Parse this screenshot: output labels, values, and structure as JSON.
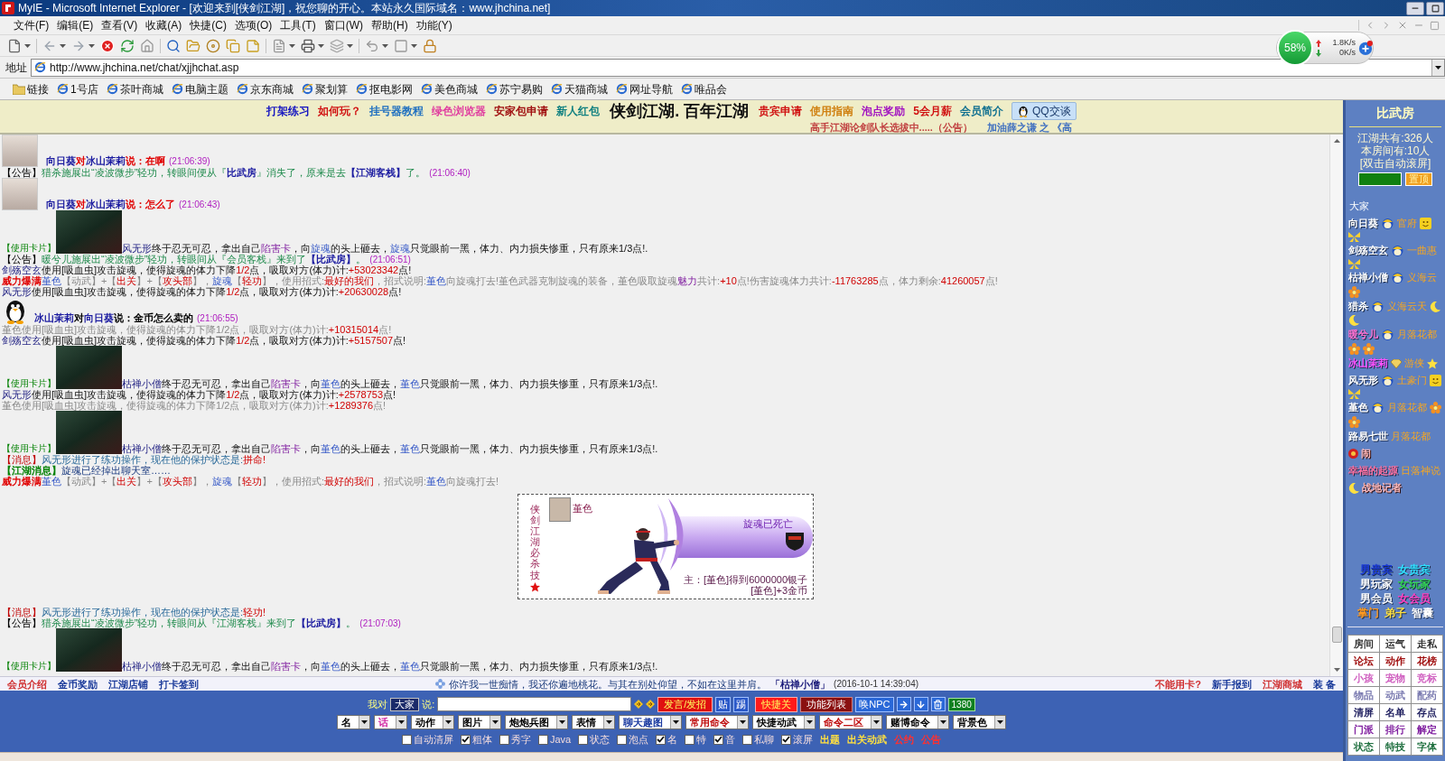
{
  "window": {
    "title": "MyIE - Microsoft Internet Explorer - [欢迎来到[侠剑江湖]，祝您聊的开心。本站永久国际域名：www.jhchina.net]"
  },
  "menu": [
    "文件(F)",
    "编辑(E)",
    "查看(V)",
    "收藏(A)",
    "快捷(C)",
    "选项(O)",
    "工具(T)",
    "窗口(W)",
    "帮助(H)",
    "功能(Y)"
  ],
  "address": {
    "label": "地址",
    "value": "http://www.jhchina.net/chat/xjjhchat.asp"
  },
  "links": [
    "链接",
    "1号店",
    "茶叶商城",
    "电脑主题",
    "京东商城",
    "聚划算",
    "抠电影网",
    "美色商城",
    "苏宁易购",
    "天猫商城",
    "网址导航",
    "唯品会"
  ],
  "speed_widget": {
    "percent": "58%",
    "up": "1.8K/s",
    "down": "0K/s"
  },
  "header": {
    "links": [
      {
        "text": "打架练习",
        "color": "#1010c0"
      },
      {
        "text": "如何玩？",
        "color": "#d01010"
      },
      {
        "text": "挂号器教程",
        "color": "#2070c0"
      },
      {
        "text": "绿色浏览器",
        "color": "#e040a0"
      },
      {
        "text": "安家包申请",
        "color": "#a01010"
      },
      {
        "text": "新人红包",
        "color": "#108080"
      }
    ],
    "title": "侠剑江湖. 百年江湖",
    "links_right": [
      {
        "text": "贵宾申请",
        "color": "#d01010"
      },
      {
        "text": "使用指南",
        "color": "#d08010"
      },
      {
        "text": "泡点奖励",
        "color": "#a010c0"
      },
      {
        "text": "5会月薪",
        "color": "#d01010"
      },
      {
        "text": "会员简介",
        "color": "#107090"
      }
    ],
    "qq_button": "QQ交谈",
    "marquee": [
      {
        "text": "高手江湖论剑队长选拔中.....（公告）",
        "color": "#c04040"
      },
      {
        "text": "加油薛之谦 之 《高",
        "color": "#4070c0"
      }
    ]
  },
  "chat": {
    "messages": [
      {
        "kind": "photo_avatar",
        "segments": [
          {
            "kind": "speaker",
            "text": "向日葵"
          },
          {
            "kind": "say",
            "text": "对"
          },
          {
            "kind": "speaker",
            "text": "冰山茉莉"
          },
          {
            "kind": "say",
            "text": "说：在啊"
          },
          {
            "kind": "time",
            "text": "(21:06:39)"
          }
        ]
      },
      {
        "kind": "text",
        "segments": [
          {
            "kind": "notice_tag",
            "text": "【公告】"
          },
          {
            "kind": "notice",
            "text": "猎杀施展出“凌波微步”轻功，转眼间便从『"
          },
          {
            "kind": "place",
            "text": "比武房"
          },
          {
            "kind": "notice",
            "text": "』消失了，原来是去"
          },
          {
            "kind": "place",
            "text": "【江湖客栈】"
          },
          {
            "kind": "notice",
            "text": "了。"
          },
          {
            "kind": "time",
            "text": "(21:06:40)"
          }
        ]
      },
      {
        "kind": "photo_avatar",
        "segments": [
          {
            "kind": "speaker",
            "text": "向日葵"
          },
          {
            "kind": "say",
            "text": "对"
          },
          {
            "kind": "speaker",
            "text": "冰山茉莉"
          },
          {
            "kind": "say",
            "text": "说：怎么了"
          },
          {
            "kind": "time",
            "text": "(21:06:43)"
          }
        ]
      },
      {
        "kind": "card",
        "tag": "【使用卡片】",
        "segments": [
          {
            "kind": "player",
            "text": "风无形"
          },
          {
            "kind": "text",
            "text": "终于忍无可忍，拿出自己"
          },
          {
            "kind": "item",
            "text": "陷害卡"
          },
          {
            "kind": "text",
            "text": "，向"
          },
          {
            "kind": "target",
            "text": "旋魂"
          },
          {
            "kind": "text",
            "text": "的头上砸去，"
          },
          {
            "kind": "target",
            "text": "旋魂"
          },
          {
            "kind": "text",
            "text": "只觉眼前一黑，体力、内力损失惨重，只有原来1/3点!."
          }
        ]
      },
      {
        "kind": "text",
        "segments": [
          {
            "kind": "notice_tag",
            "text": "【公告】"
          },
          {
            "kind": "notice",
            "text": "暖兮儿施展出“凌波微步”轻功，转眼间从『会员客栈』来到了"
          },
          {
            "kind": "place",
            "text": "【比武房】"
          },
          {
            "kind": "notice",
            "text": "。"
          },
          {
            "kind": "time",
            "text": "(21:06:51)"
          }
        ]
      },
      {
        "kind": "text",
        "segments": [
          {
            "kind": "player",
            "text": "剑殇空玄"
          },
          {
            "kind": "text",
            "text": "使用[吸血虫]攻击旋魂，使得旋魂的体力下降"
          },
          {
            "kind": "num",
            "text": "1/2"
          },
          {
            "kind": "text",
            "text": "点，吸取对方(体力)计:"
          },
          {
            "kind": "num",
            "text": "+53023342"
          },
          {
            "kind": "text",
            "text": "点!"
          }
        ]
      },
      {
        "kind": "text",
        "segments": [
          {
            "kind": "power",
            "text": "威力爆满"
          },
          {
            "kind": "target",
            "text": "堇色"
          },
          {
            "kind": "dim",
            "text": "【动武】+【"
          },
          {
            "kind": "red",
            "text": "出关"
          },
          {
            "kind": "dim",
            "text": "】+【"
          },
          {
            "kind": "red",
            "text": "攻头部"
          },
          {
            "kind": "dim",
            "text": "】，"
          },
          {
            "kind": "target",
            "text": "旋魂"
          },
          {
            "kind": "dim",
            "text": "【"
          },
          {
            "kind": "red",
            "text": "轻功"
          },
          {
            "kind": "dim",
            "text": "】，使用招式:"
          },
          {
            "kind": "red",
            "text": "最好的我们"
          },
          {
            "kind": "dim",
            "text": "，招式说明:"
          },
          {
            "kind": "target",
            "text": "堇色"
          },
          {
            "kind": "dim",
            "text": "向旋魂打去!堇色武器克制旋魂的装备，堇色吸取旋魂"
          },
          {
            "kind": "item",
            "text": "魅力"
          },
          {
            "kind": "dim",
            "text": "共计:"
          },
          {
            "kind": "num",
            "text": "+10"
          },
          {
            "kind": "dim",
            "text": "点!伤害旋魂体力共计:"
          },
          {
            "kind": "num",
            "text": "-11763285"
          },
          {
            "kind": "dim",
            "text": "点，体力剩余:"
          },
          {
            "kind": "num",
            "text": "41260057"
          },
          {
            "kind": "dim",
            "text": "点!"
          }
        ]
      },
      {
        "kind": "text",
        "segments": [
          {
            "kind": "player",
            "text": "风无形"
          },
          {
            "kind": "text",
            "text": "使用[吸血虫]攻击旋魂，使得旋魂的体力下降"
          },
          {
            "kind": "num",
            "text": "1/2"
          },
          {
            "kind": "text",
            "text": "点，吸取对方(体力)计:"
          },
          {
            "kind": "num",
            "text": "+20630028"
          },
          {
            "kind": "text",
            "text": "点!"
          }
        ]
      },
      {
        "kind": "penguin_avatar",
        "segments": [
          {
            "kind": "speaker",
            "text": "冰山茉莉"
          },
          {
            "kind": "talk",
            "text": "对"
          },
          {
            "kind": "speaker",
            "text": "向日葵"
          },
          {
            "kind": "talk",
            "text": "说：金币怎么卖的"
          },
          {
            "kind": "time",
            "text": "(21:06:55)"
          }
        ]
      },
      {
        "kind": "text",
        "segments": [
          {
            "kind": "dim",
            "text": "堇色使用[吸血虫]攻击旋魂，使得旋魂的体力下降1/2点，吸取对方(体力)计:"
          },
          {
            "kind": "num",
            "text": "+10315014"
          },
          {
            "kind": "dim",
            "text": "点!"
          }
        ]
      },
      {
        "kind": "text",
        "segments": [
          {
            "kind": "player",
            "text": "剑殇空玄"
          },
          {
            "kind": "text",
            "text": "使用[吸血虫]攻击旋魂，使得旋魂的体力下降"
          },
          {
            "kind": "num",
            "text": "1/2"
          },
          {
            "kind": "text",
            "text": "点，吸取对方(体力)计:"
          },
          {
            "kind": "num",
            "text": "+5157507"
          },
          {
            "kind": "text",
            "text": "点!"
          }
        ]
      },
      {
        "kind": "card",
        "tag": "【使用卡片】",
        "segments": [
          {
            "kind": "player",
            "text": "枯禅小僧"
          },
          {
            "kind": "text",
            "text": "终于忍无可忍，拿出自己"
          },
          {
            "kind": "item",
            "text": "陷害卡"
          },
          {
            "kind": "text",
            "text": "，向"
          },
          {
            "kind": "target",
            "text": "堇色"
          },
          {
            "kind": "text",
            "text": "的头上砸去，"
          },
          {
            "kind": "target",
            "text": "堇色"
          },
          {
            "kind": "text",
            "text": "只觉眼前一黑，体力、内力损失惨重，只有原来1/3点!."
          }
        ]
      },
      {
        "kind": "text",
        "segments": [
          {
            "kind": "player",
            "text": "风无形"
          },
          {
            "kind": "text",
            "text": "使用[吸血虫]攻击旋魂，使得旋魂的体力下降"
          },
          {
            "kind": "num",
            "text": "1/2"
          },
          {
            "kind": "text",
            "text": "点，吸取对方(体力)计:"
          },
          {
            "kind": "num",
            "text": "+2578753"
          },
          {
            "kind": "text",
            "text": "点!"
          }
        ]
      },
      {
        "kind": "text",
        "segments": [
          {
            "kind": "dim",
            "text": "堇色使用[吸血虫]攻击旋魂，使得旋魂的体力下降1/2点，吸取对方(体力)计:"
          },
          {
            "kind": "num",
            "text": "+1289376"
          },
          {
            "kind": "dim",
            "text": "点!"
          }
        ]
      },
      {
        "kind": "card",
        "tag": "【使用卡片】",
        "segments": [
          {
            "kind": "player",
            "text": "枯禅小僧"
          },
          {
            "kind": "text",
            "text": "终于忍无可忍，拿出自己"
          },
          {
            "kind": "item",
            "text": "陷害卡"
          },
          {
            "kind": "text",
            "text": "，向"
          },
          {
            "kind": "target",
            "text": "堇色"
          },
          {
            "kind": "text",
            "text": "的头上砸去，"
          },
          {
            "kind": "target",
            "text": "堇色"
          },
          {
            "kind": "text",
            "text": "只觉眼前一黑，体力、内力损失惨重，只有原来1/3点!."
          }
        ]
      },
      {
        "kind": "text",
        "segments": [
          {
            "kind": "msg_tag",
            "text": "【消息】"
          },
          {
            "kind": "msg",
            "text": "风无形进行了练功操作，现在他的保护状态是:"
          },
          {
            "kind": "red",
            "text": "拼命!"
          }
        ]
      },
      {
        "kind": "text",
        "segments": [
          {
            "kind": "news_tag",
            "text": "【江湖消息】"
          },
          {
            "kind": "news",
            "text": "旋魂已经掉出聊天室……"
          }
        ]
      },
      {
        "kind": "text",
        "segments": [
          {
            "kind": "power",
            "text": "威力爆满"
          },
          {
            "kind": "target",
            "text": "堇色"
          },
          {
            "kind": "dim",
            "text": "【动武】+【"
          },
          {
            "kind": "red",
            "text": "出关"
          },
          {
            "kind": "dim",
            "text": "】+【"
          },
          {
            "kind": "red",
            "text": "攻头部"
          },
          {
            "kind": "dim",
            "text": "】，"
          },
          {
            "kind": "target",
            "text": "旋魂"
          },
          {
            "kind": "dim",
            "text": "【"
          },
          {
            "kind": "red",
            "text": "轻功"
          },
          {
            "kind": "dim",
            "text": "】，使用招式:"
          },
          {
            "kind": "red",
            "text": "最好的我们"
          },
          {
            "kind": "dim",
            "text": "，招式说明:"
          },
          {
            "kind": "target",
            "text": "堇色"
          },
          {
            "kind": "dim",
            "text": "向旋魂打去!"
          }
        ]
      },
      {
        "kind": "battle",
        "caption": "侠剑江湖必杀技",
        "fighter": "堇色",
        "status": "旋魂已死亡",
        "rewards": [
          "主：[堇色]得到6000000银子",
          "[堇色]+3金币"
        ]
      },
      {
        "kind": "text",
        "segments": [
          {
            "kind": "msg_tag",
            "text": "【消息】"
          },
          {
            "kind": "msg",
            "text": "风无形进行了练功操作，现在他的保护状态是:"
          },
          {
            "kind": "red",
            "text": "轻功!"
          }
        ]
      },
      {
        "kind": "text",
        "segments": [
          {
            "kind": "notice_tag",
            "text": "【公告】"
          },
          {
            "kind": "notice",
            "text": "猎杀施展出“凌波微步”轻功，转眼间从『江湖客栈』来到了"
          },
          {
            "kind": "place",
            "text": "【比武房】"
          },
          {
            "kind": "notice",
            "text": "。"
          },
          {
            "kind": "time",
            "text": "(21:07:03)"
          }
        ]
      },
      {
        "kind": "card",
        "tag": "【使用卡片】",
        "segments": [
          {
            "kind": "player",
            "text": "枯禅小僧"
          },
          {
            "kind": "text",
            "text": "终于忍无可忍，拿出自己"
          },
          {
            "kind": "item",
            "text": "陷害卡"
          },
          {
            "kind": "text",
            "text": "，向"
          },
          {
            "kind": "target",
            "text": "堇色"
          },
          {
            "kind": "text",
            "text": "的头上砸去，"
          },
          {
            "kind": "target",
            "text": "堇色"
          },
          {
            "kind": "text",
            "text": "只觉眼前一黑，体力、内力损失惨重，只有原来1/3点!."
          }
        ]
      }
    ]
  },
  "bottom_bar": {
    "left_links": [
      {
        "text": "会员介绍",
        "color": "#d03030"
      },
      {
        "text": "金币奖励",
        "color": "#1a3a9a"
      },
      {
        "text": "江湖店铺",
        "color": "#1a3a9a"
      },
      {
        "text": "打卡签到",
        "color": "#1a3a9a"
      }
    ],
    "quote": "你许我一世痴情，我还你遍地桃花。与其在别处仰望，不如在这里并肩。",
    "quote_author": "「枯禅小僧」",
    "quote_time": "(2016-10-1 14:39:04)",
    "right_links": [
      {
        "text": "不能用卡?",
        "color": "#d03030"
      },
      {
        "text": "新手报到",
        "color": "#1a3a9a"
      },
      {
        "text": "江湖商城",
        "color": "#d03030"
      },
      {
        "text": "装 备",
        "color": "#1a3a9a"
      }
    ]
  },
  "composer": {
    "to_label": "我对",
    "to_value": "大家",
    "say_label": "说:",
    "buttons": [
      {
        "kind": "send",
        "text": "发言/发招"
      },
      {
        "kind": "small",
        "text": "贴"
      },
      {
        "kind": "small",
        "text": "踢"
      },
      {
        "kind": "hot",
        "text": "快捷关"
      },
      {
        "kind": "menu",
        "text": "功能列表"
      },
      {
        "kind": "npc",
        "text": "唤NPC"
      }
    ],
    "counter": "1380",
    "selects": [
      {
        "value": "名",
        "color": "#000000"
      },
      {
        "value": "话",
        "color": "#d020a0"
      },
      {
        "value": "动作",
        "color": "#000000"
      },
      {
        "value": "图片",
        "color": "#000000"
      },
      {
        "value": "炮炮兵图",
        "color": "#000000"
      },
      {
        "value": "表情",
        "color": "#000000"
      },
      {
        "value": "聊天趣图",
        "color": "#1a3aa0"
      },
      {
        "value": "常用命令",
        "color": "#c01010"
      },
      {
        "value": "快捷动武",
        "color": "#000000"
      },
      {
        "value": "命令二区",
        "color": "#c01010"
      },
      {
        "value": "赌博命令",
        "color": "#000000"
      },
      {
        "value": "背景色",
        "color": "#000000"
      }
    ],
    "options": [
      {
        "label": "自动清屏",
        "checked": false
      },
      {
        "label": "粗体",
        "checked": true
      },
      {
        "label": "秀字",
        "checked": false
      },
      {
        "label": "Java",
        "checked": false
      },
      {
        "label": "状态",
        "checked": false
      },
      {
        "label": "泡点",
        "checked": false
      },
      {
        "label": "名",
        "checked": true
      },
      {
        "label": "特",
        "checked": false
      },
      {
        "label": "音",
        "checked": true
      },
      {
        "label": "私聊",
        "checked": false
      },
      {
        "label": "滚屏",
        "checked": true
      }
    ],
    "links": [
      {
        "text": "出题",
        "color": "#ffe040"
      },
      {
        "text": "出关动武",
        "color": "#ffe040"
      },
      {
        "text": "公约",
        "color": "#ff3030"
      },
      {
        "text": "公告",
        "color": "#ff3030"
      }
    ]
  },
  "sidebar": {
    "room": "比武房",
    "total": "江湖共有:326人",
    "here": "本房间有:10人",
    "scroll_hint": "[双击自动滚屏]",
    "pin_button": "置顶",
    "everyone": "大家",
    "users": [
      {
        "name": "向日葵",
        "color": "#ffffff",
        "emblem": {
          "kind": "helmet"
        },
        "faction": "官府",
        "badges": [
          {
            "kind": "face"
          },
          {
            "kind": "butterfly"
          }
        ]
      },
      {
        "name": "剑殇空玄",
        "color": "#ffffff",
        "emblem": {
          "kind": "helmet"
        },
        "faction": "一曲惠",
        "badges": [
          {
            "kind": "butterfly"
          }
        ]
      },
      {
        "name": "枯禅小僧",
        "color": "#ffffff",
        "emblem": {
          "kind": "helmet"
        },
        "faction": "义海云",
        "badges": [
          {
            "kind": "flower"
          }
        ]
      },
      {
        "name": "猎杀",
        "color": "#ffffff",
        "emblem": {
          "kind": "helmet"
        },
        "faction": "义海云天",
        "badges": [
          {
            "kind": "moon"
          },
          {
            "kind": "moon"
          }
        ]
      },
      {
        "name": "暖兮儿",
        "color": "#ff70d0",
        "emblem": {
          "kind": "helmet"
        },
        "faction": "月落花都",
        "badges": [
          {
            "kind": "flower"
          },
          {
            "kind": "flower"
          }
        ]
      },
      {
        "name": "冰山茉莉",
        "color": "#ff50ff",
        "emblem": {
          "kind": "gem"
        },
        "faction": "游侠",
        "badges": [
          {
            "kind": "star"
          }
        ]
      },
      {
        "name": "风无形",
        "color": "#ffffff",
        "emblem": {
          "kind": "helmet"
        },
        "faction": "土豪门",
        "badges": [
          {
            "kind": "face"
          },
          {
            "kind": "butterfly"
          }
        ]
      },
      {
        "name": "堇色",
        "color": "#ffffff",
        "emblem": {
          "kind": "helmet"
        },
        "faction": "月落花都",
        "badges": [
          {
            "kind": "flower"
          },
          {
            "kind": "flower"
          }
        ]
      },
      {
        "name": "路易七世",
        "color": "#ffffff",
        "faction": "月落花都",
        "badges": [
          {
            "kind": "medal"
          }
        ],
        "note": "闹"
      },
      {
        "name": "幸福的起源",
        "color": "#ff70a0",
        "faction": "日落神说",
        "badges": [
          {
            "kind": "moon"
          }
        ],
        "note": "战地记者"
      }
    ],
    "legend": [
      [
        {
          "text": "男贵宾",
          "color": "#1a3ad8"
        },
        {
          "text": "女贵宾",
          "color": "#30e0ff"
        }
      ],
      [
        {
          "text": "男玩家",
          "color": "#ffffff"
        },
        {
          "text": "女玩家",
          "color": "#30d050"
        }
      ],
      [
        {
          "text": "男会员",
          "color": "#ffffff"
        },
        {
          "text": "女会员",
          "color": "#ff40c0"
        }
      ],
      [
        {
          "text": "掌门",
          "color": "#ff9a20"
        },
        {
          "text": "弟子",
          "color": "#ffe040"
        },
        {
          "text": "智囊",
          "color": "#ffffff"
        }
      ]
    ],
    "commands": [
      {
        "text": "房间",
        "color": "#333333"
      },
      {
        "text": "运气",
        "color": "#333333"
      },
      {
        "text": "走私",
        "color": "#333333"
      },
      {
        "text": "论坛",
        "color": "#a01010"
      },
      {
        "text": "动作",
        "color": "#a01010"
      },
      {
        "text": "花榜",
        "color": "#a01010"
      },
      {
        "text": "小孩",
        "color": "#d060c0"
      },
      {
        "text": "宠物",
        "color": "#d060c0"
      },
      {
        "text": "竞标",
        "color": "#d060c0"
      },
      {
        "text": "物品",
        "color": "#7a7ab0"
      },
      {
        "text": "动武",
        "color": "#7a7ab0"
      },
      {
        "text": "配药",
        "color": "#7a7ab0"
      },
      {
        "text": "清屏",
        "color": "#202060"
      },
      {
        "text": "名单",
        "color": "#202060"
      },
      {
        "text": "存点",
        "color": "#202060"
      },
      {
        "text": "门派",
        "color": "#8020a0"
      },
      {
        "text": "排行",
        "color": "#8020a0"
      },
      {
        "text": "解定",
        "color": "#8020a0"
      },
      {
        "text": "状态",
        "color": "#207040"
      },
      {
        "text": "特技",
        "color": "#207040"
      },
      {
        "text": "字体",
        "color": "#207040"
      }
    ]
  }
}
